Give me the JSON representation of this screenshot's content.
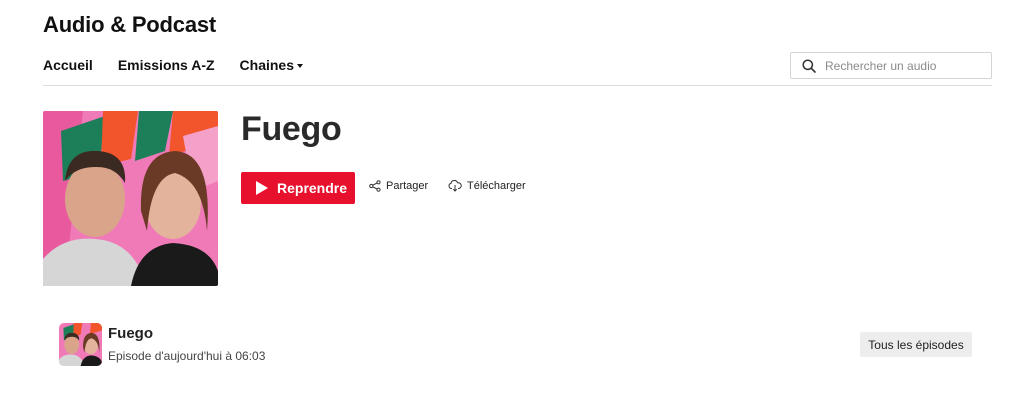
{
  "header": {
    "site_title": "Audio & Podcast",
    "nav": [
      {
        "label": "Accueil"
      },
      {
        "label": "Emissions A-Z"
      },
      {
        "label": "Chaines",
        "has_dropdown": true
      }
    ],
    "search": {
      "placeholder": "Rechercher un audio",
      "value": ""
    }
  },
  "show": {
    "title": "Fuego",
    "play_label": "Reprendre",
    "share_label": "Partager",
    "download_label": "Télécharger",
    "accent_color": "#e8112d"
  },
  "latest_episode": {
    "title": "Fuego",
    "subtitle": "Episode d'aujourd'hui à 06:03",
    "all_episodes_label": "Tous les épisodes"
  },
  "icons": [
    "search-icon",
    "play-icon",
    "share-icon",
    "download-icon",
    "chevron-down-icon"
  ]
}
